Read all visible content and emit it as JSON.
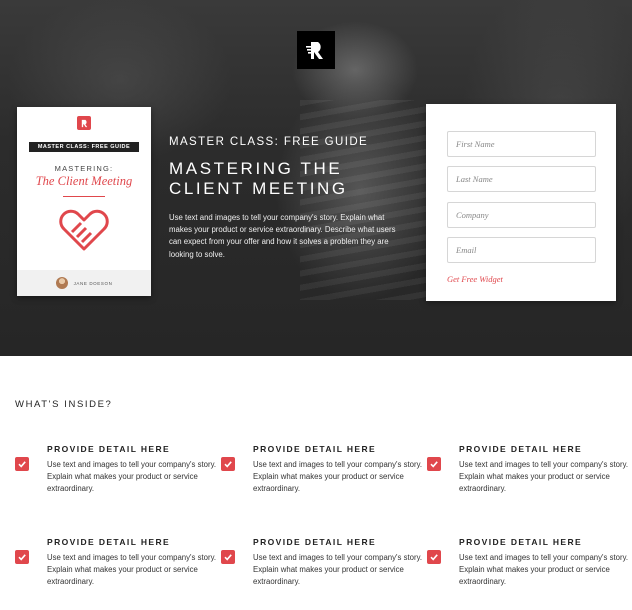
{
  "hero": {
    "kicker": "MASTER CLASS: FREE GUIDE",
    "headline_line1": "MASTERING THE",
    "headline_line2": "CLIENT MEETING",
    "description": "Use text and images to tell your company's story. Explain what makes your product or service extraordinary. Describe what users can expect from your offer and how it solves a problem they are looking to solve."
  },
  "book": {
    "band": "MASTER CLASS: FREE GUIDE",
    "kicker": "MASTERING:",
    "title": "The Client Meeting",
    "author": "JANE DOESON"
  },
  "form": {
    "first_name_placeholder": "First Name",
    "last_name_placeholder": "Last Name",
    "company_placeholder": "Company",
    "email_placeholder": "Email",
    "submit_label": "Get Free Widget"
  },
  "inside": {
    "title": "WHAT'S INSIDE?",
    "items": [
      {
        "title": "PROVIDE DETAIL HERE",
        "text": "Use text and images to tell your company's story. Explain what makes your product or service extraordinary."
      },
      {
        "title": "PROVIDE DETAIL HERE",
        "text": "Use text and images to tell your company's story. Explain what makes your product or service extraordinary."
      },
      {
        "title": "PROVIDE DETAIL HERE",
        "text": "Use text and images to tell your company's story. Explain what makes your product or service extraordinary."
      },
      {
        "title": "PROVIDE DETAIL HERE",
        "text": "Use text and images to tell your company's story. Explain what makes your product or service extraordinary."
      },
      {
        "title": "PROVIDE DETAIL HERE",
        "text": "Use text and images to tell your company's story. Explain what makes your product or service extraordinary."
      },
      {
        "title": "PROVIDE DETAIL HERE",
        "text": "Use text and images to tell your company's story. Explain what makes your product or service extraordinary."
      }
    ]
  },
  "icons": {
    "logo": "brand-logo-icon",
    "check": "checkbox-checked-icon",
    "book_art": "handshake-icon"
  },
  "colors": {
    "accent": "#e0474c",
    "hero_bg": "#2c2c2c"
  }
}
